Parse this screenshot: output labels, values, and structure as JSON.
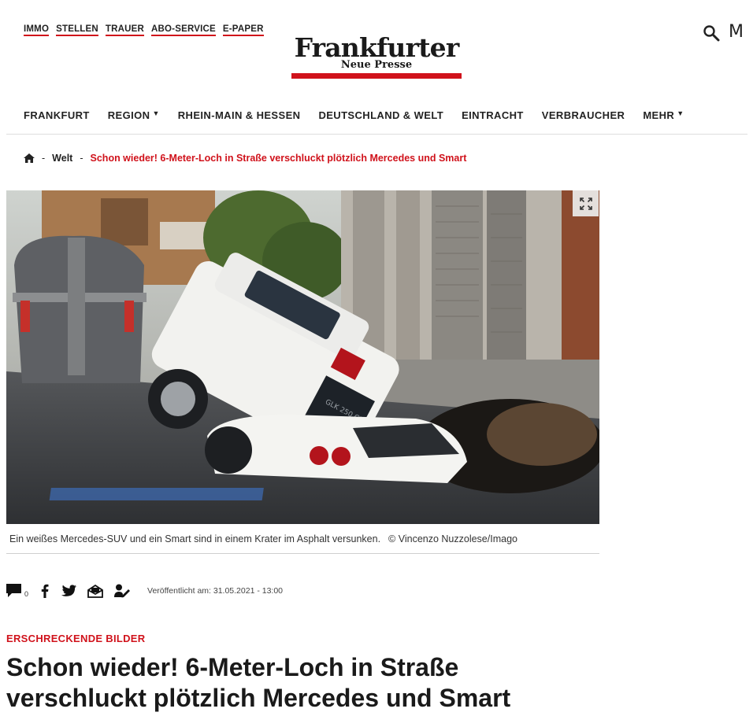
{
  "top_links": [
    "IMMO",
    "STELLEN",
    "TRAUER",
    "ABO-SERVICE",
    "E-PAPER"
  ],
  "logo": {
    "main": "Frankfurter",
    "sub": "Neue Presse"
  },
  "header": {
    "menu_letter": "M"
  },
  "nav": {
    "frankfurt": "FRANKFURT",
    "region": "REGION",
    "rhein_main": "RHEIN-MAIN & HESSEN",
    "deutschland": "DEUTSCHLAND & WELT",
    "eintracht": "EINTRACHT",
    "verbraucher": "VERBRAUCHER",
    "mehr": "MEHR",
    "caret": "▼"
  },
  "breadcrumb": {
    "sep": "-",
    "section": "Welt",
    "current": "Schon wieder! 6-Meter-Loch in Straße verschluckt plötzlich Mercedes und Smart"
  },
  "image": {
    "caption": "Ein weißes Mercedes-SUV und ein Smart sind in einem Krater im Asphalt versunken.",
    "credit": "© Vincenzo Nuzzolese/Imago",
    "suv_badge": "GLK 250 CDI"
  },
  "share": {
    "comment_count": "0",
    "published": "Veröffentlicht am: 31.05.2021 - 13:00",
    "icons": [
      "comment-icon",
      "facebook-icon",
      "twitter-icon",
      "email-icon",
      "author-icon"
    ]
  },
  "article": {
    "kicker": "ERSCHRECKENDE BILDER",
    "title": "Schon wieder! 6-Meter-Loch in Straße verschluckt plötzlich Mercedes und Smart"
  },
  "colors": {
    "brand_red": "#d0121b",
    "text": "#222222"
  }
}
